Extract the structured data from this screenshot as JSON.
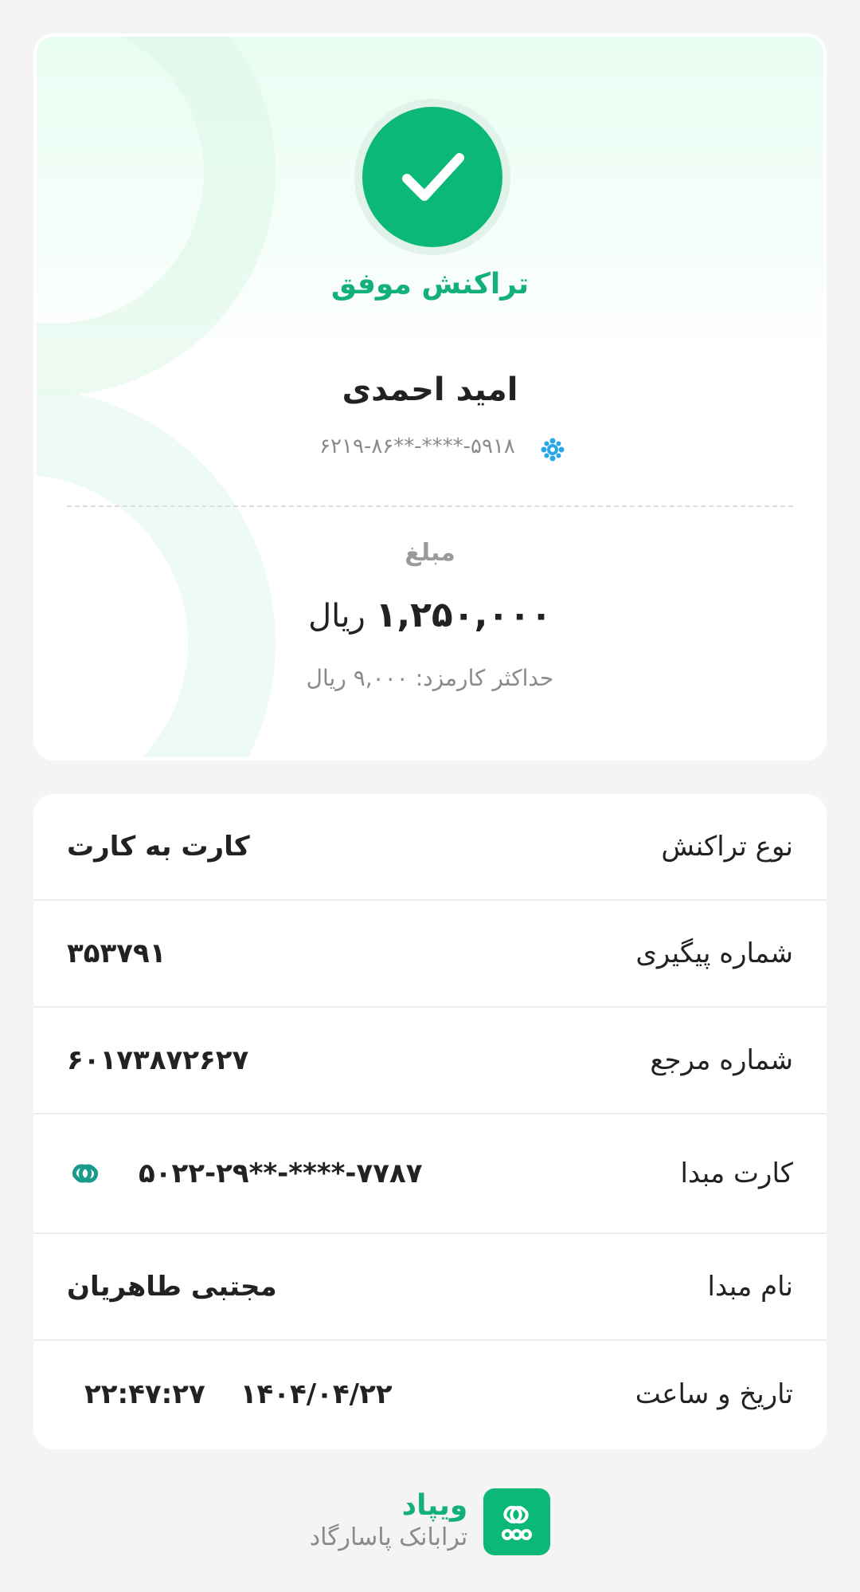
{
  "colors": {
    "accent_green": "#0cb877",
    "background": "#f4f4f4",
    "card": "#ffffff",
    "muted_text": "#8a8a8a"
  },
  "status": {
    "icon": "check-icon",
    "title": "تراکنش موفق"
  },
  "receiver": {
    "name": "امید احمدی",
    "card_number": "۶۲۱۹-۸۶**-****-۵۹۱۸",
    "bank_icon": "bank-logo-icon"
  },
  "amount": {
    "label": "مبلغ",
    "value": "۱,۲۵۰,۰۰۰",
    "currency": "ریال",
    "fee_label": "حداکثر کارمزد:",
    "fee_value": "۹,۰۰۰",
    "fee_currency": "ریال"
  },
  "details": [
    {
      "label": "نوع تراکنش",
      "value": "کارت به کارت"
    },
    {
      "label": "شماره پیگیری",
      "value": "۳۵۳۷۹۱"
    },
    {
      "label": "شماره مرجع",
      "value": "۶۰۱۷۳۸۷۲۶۲۷"
    },
    {
      "label": "کارت مبدا",
      "value": "۵۰۲۲-۲۹**-****-۷۷۸۷",
      "icon": "wepod-link-icon"
    },
    {
      "label": "نام مبدا",
      "value": "مجتبی طاهریان"
    },
    {
      "label": "تاریخ و ساعت",
      "date": "۱۴۰۴/۰۴/۲۲",
      "time": "۲۲:۴۷:۲۷"
    }
  ],
  "footer": {
    "brand": "ویپاد",
    "subtitle": "ترابانک پاسارگاد",
    "logo_icon": "wepod-logo-icon"
  }
}
